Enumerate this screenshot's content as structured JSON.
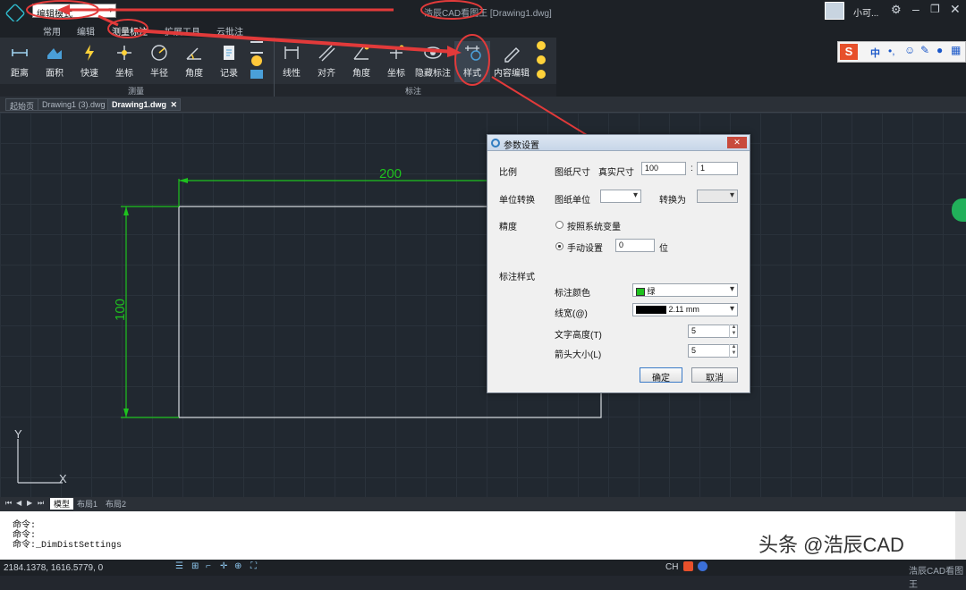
{
  "titlebar": {
    "mode_select": "编辑模式",
    "app_name": "浩辰CAD看图王",
    "doc_name": "[Drawing1.dwg]",
    "user_name": "小可..."
  },
  "menu": [
    "常用",
    "编辑",
    "测量标注",
    "扩展工具",
    "云批注"
  ],
  "ribbon": {
    "measure_buttons": [
      "距离",
      "面积",
      "快速",
      "坐标",
      "半径",
      "角度",
      "记录"
    ],
    "measure_group": "测量",
    "dim_buttons": [
      "线性",
      "对齐",
      "角度",
      "坐标",
      "隐藏标注",
      "样式",
      "内容编辑"
    ],
    "dim_group": "标注"
  },
  "ime_toolbar": [
    "中"
  ],
  "tabs": [
    "起始页",
    "Drawing1 (3).dwg",
    "Drawing1.dwg"
  ],
  "drawing": {
    "dim_horizontal": "200",
    "dim_vertical": "100",
    "ucs_y": "Y",
    "ucs_x": "X",
    "colors": {
      "dim": "#1ec21e",
      "rect": "#d8dce0"
    }
  },
  "dialog": {
    "title": "参数设置",
    "scale_label": "比例",
    "paper_size_label": "图纸尺寸",
    "real_size_label": "真实尺寸",
    "paper_size_value": "100",
    "ratio_sep": ":",
    "ratio_value": "1",
    "unit_label": "单位转换",
    "paper_unit_label": "图纸单位",
    "convert_label": "转换为",
    "precision_label": "精度",
    "opt_system": "按照系统变量",
    "opt_manual": "手动设置",
    "manual_value": "0",
    "manual_unit": "位",
    "dim_style_label": "标注样式",
    "dim_color_label": "标注颜色",
    "dim_color_value": "绿",
    "linewidth_label": "线宽(@)",
    "linewidth_value": "2.11 mm",
    "text_height_label": "文字高度(T)",
    "text_height_value": "5",
    "arrow_size_label": "箭头大小(L)",
    "arrow_size_value": "5",
    "ok_label": "确定",
    "cancel_label": "取消"
  },
  "layout_tabs": [
    "模型",
    "布局1",
    "布局2"
  ],
  "command": {
    "line1": "命令:",
    "line2": "命令:",
    "line3": "命令:_DimDistSettings"
  },
  "status": {
    "coords": "2184.1378, 1616.5779, 0",
    "right_text": "浩辰CAD看图王"
  },
  "watermark": "头条 @浩辰CAD"
}
